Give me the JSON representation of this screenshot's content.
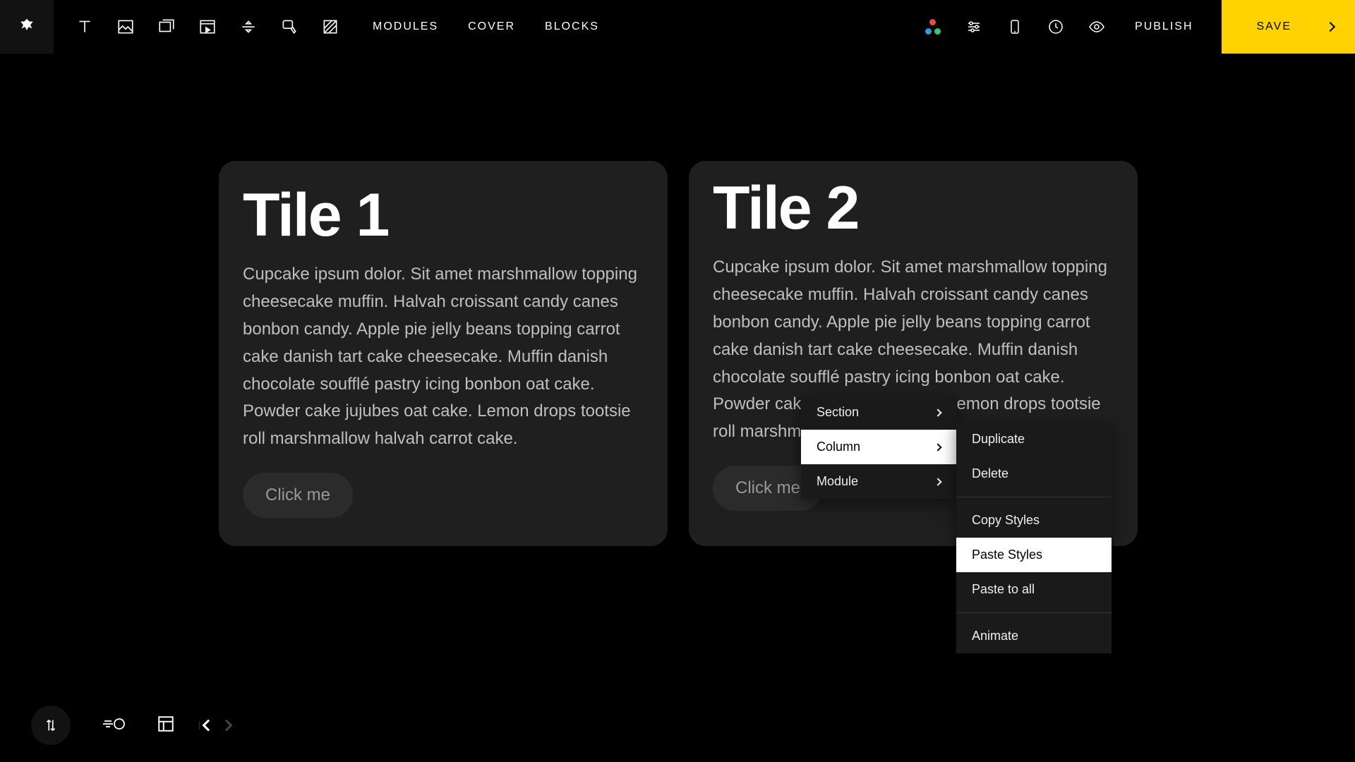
{
  "topbar": {
    "nav": {
      "modules": "MODULES",
      "cover": "COVER",
      "blocks": "BLOCKS"
    },
    "publish": "PUBLISH",
    "save": "SAVE"
  },
  "tiles": [
    {
      "title": "Tile 1",
      "body": "Cupcake ipsum dolor. Sit amet marshmallow topping cheesecake muffin. Halvah croissant candy canes bonbon candy. Apple pie jelly beans topping carrot cake danish tart cake cheesecake. Muffin danish chocolate soufflé pastry icing bonbon oat cake. Powder cake jujubes oat cake. Lemon drops tootsie roll marshmallow halvah carrot cake.",
      "button": "Click me"
    },
    {
      "title": "Tile 2",
      "body": "Cupcake ipsum dolor. Sit amet marshmallow topping cheesecake muffin. Halvah croissant candy canes bonbon candy. Apple pie jelly beans topping carrot cake danish tart cake cheesecake. Muffin danish chocolate soufflé pastry icing bonbon oat cake. Powder cake jujubes oat cake. Lemon drops tootsie roll marshmallow halvah carrot cake.",
      "button": "Click me"
    }
  ],
  "context_menu": {
    "items": [
      {
        "label": "Section",
        "has_submenu": true
      },
      {
        "label": "Column",
        "has_submenu": true,
        "active": true
      },
      {
        "label": "Module",
        "has_submenu": true
      }
    ],
    "submenu": {
      "group1": [
        "Duplicate",
        "Delete"
      ],
      "group2": [
        "Copy Styles",
        "Paste Styles",
        "Paste to all"
      ],
      "group3": [
        "Animate"
      ],
      "active": "Paste Styles"
    }
  }
}
